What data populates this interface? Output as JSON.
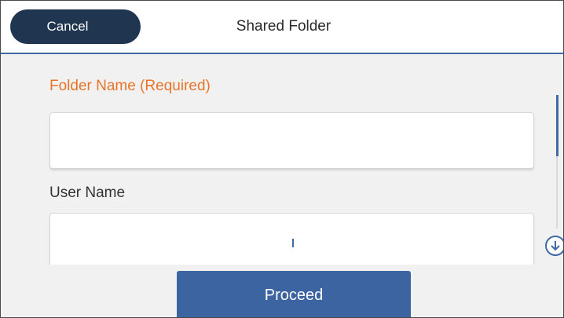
{
  "header": {
    "cancel_label": "Cancel",
    "title": "Shared Folder"
  },
  "form": {
    "folder_name_label": "Folder Name (Required)",
    "folder_name_value": "",
    "user_name_label": "User Name",
    "user_name_value": ""
  },
  "footer": {
    "proceed_label": "Proceed"
  },
  "icons": {
    "scroll_down": "arrow-down-circle-icon"
  },
  "colors": {
    "accent": "#3c64a0",
    "required_label": "#e8742a",
    "cancel_button": "#1f3550"
  }
}
